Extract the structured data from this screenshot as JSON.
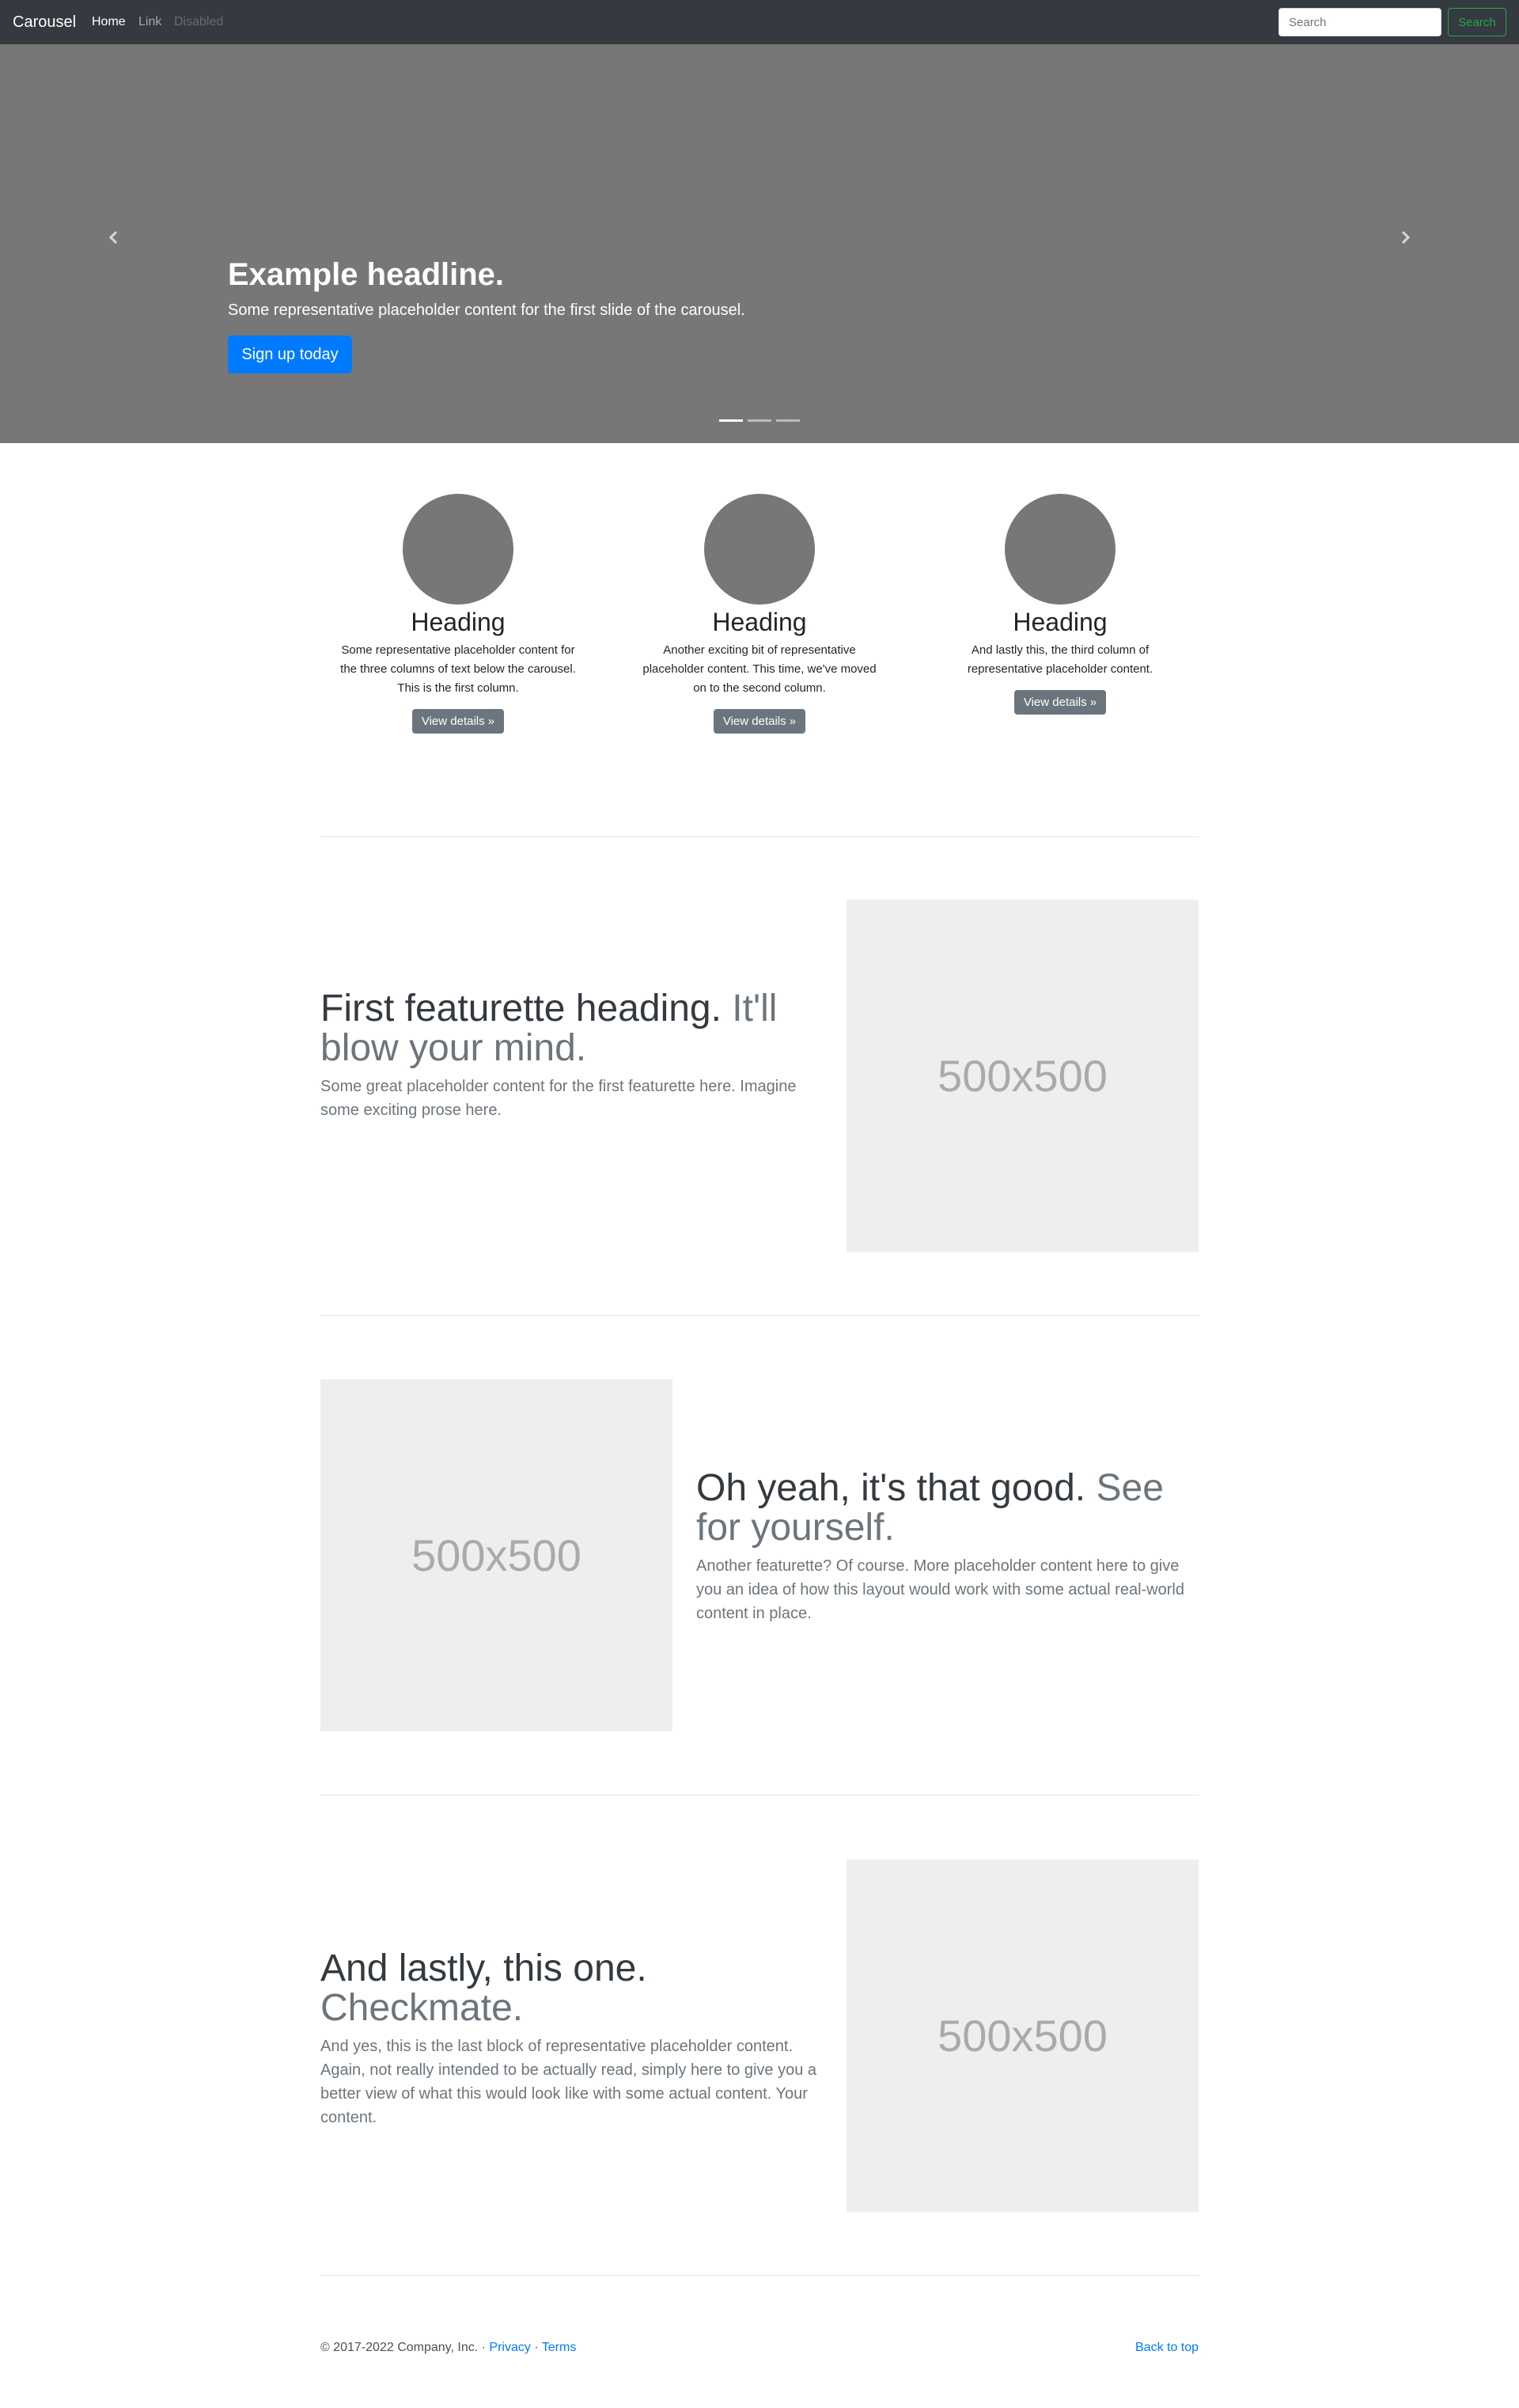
{
  "navbar": {
    "brand": "Carousel",
    "links": [
      "Home",
      "Link",
      "Disabled"
    ],
    "search_placeholder": "Search",
    "search_button": "Search"
  },
  "carousel": {
    "prev_icon": "chevron-left-icon",
    "next_icon": "chevron-right-icon",
    "headline": "Example headline.",
    "text": "Some representative placeholder content for the first slide of the carousel.",
    "button": "Sign up today",
    "slide_count": 3,
    "active_slide": 1
  },
  "columns": [
    {
      "heading": "Heading",
      "text": "Some representative placeholder content for the three columns of text below the carousel. This is the first column.",
      "button": "View details »"
    },
    {
      "heading": "Heading",
      "text": "Another exciting bit of representative placeholder content. This time, we've moved on to the second column.",
      "button": "View details »"
    },
    {
      "heading": "Heading",
      "text": "And lastly this, the third column of representative placeholder content.",
      "button": "View details »"
    }
  ],
  "featurettes": [
    {
      "heading": "First featurette heading.",
      "muted": "It'll blow your mind.",
      "lead": "Some great placeholder content for the first featurette here. Imagine some exciting prose here.",
      "image": "500x500"
    },
    {
      "heading": "Oh yeah, it's that good.",
      "muted": "See for yourself.",
      "lead": "Another featurette? Of course. More placeholder content here to give you an idea of how this layout would work with some actual real-world content in place.",
      "image": "500x500"
    },
    {
      "heading": "And lastly, this one.",
      "muted": "Checkmate.",
      "lead": "And yes, this is the last block of representative placeholder content. Again, not really intended to be actually read, simply here to give you a better view of what this would look like with some actual content. Your content.",
      "image": "500x500"
    }
  ],
  "footer": {
    "copyright": "© 2017-2022 Company, Inc. · ",
    "privacy": "Privacy",
    "separator": " · ",
    "terms": "Terms",
    "back_to_top": "Back to top"
  },
  "colors": {
    "navbar": "#343a40",
    "carousel_bg": "#777777",
    "primary": "#007bff",
    "secondary": "#6c757d",
    "success": "#28a745"
  }
}
